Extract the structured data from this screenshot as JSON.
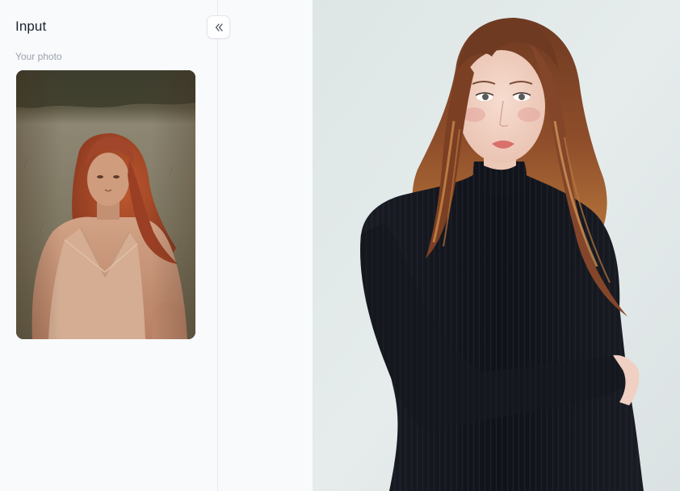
{
  "sidebar": {
    "title": "Input",
    "collapse_icon": "double-chevron-left-icon",
    "section_label": "Your photo"
  },
  "input_image": {
    "description_icon": "photo",
    "colors": {
      "background_top": "#4a4e3c",
      "background_grass": "#7d7c6a",
      "hair": "#a2482a",
      "skin": "#c99a7e",
      "dress": "#d9b39a"
    }
  },
  "result_image": {
    "colors": {
      "backdrop": "#e3e9e9",
      "sweater": "#14161d",
      "hair": "#8a4a2a",
      "skin": "#f1d2c3"
    }
  }
}
